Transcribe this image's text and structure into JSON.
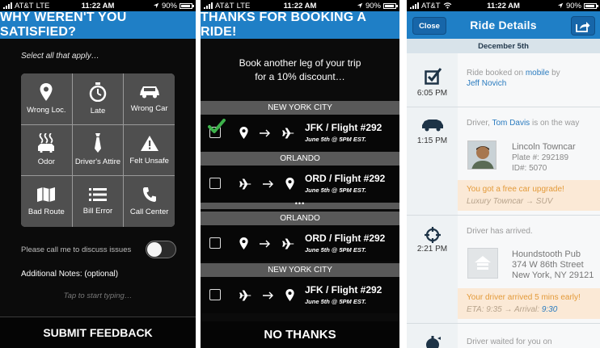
{
  "status_bar": {
    "carrier": "AT&T",
    "network": "LTE",
    "time": "11:22 AM",
    "battery": "90%"
  },
  "feedback_screen": {
    "title": "WHY WEREN'T YOU SATISFIED?",
    "instruction": "Select all that apply…",
    "options": [
      {
        "label": "Wrong Loc.",
        "icon": "map-pin-icon"
      },
      {
        "label": "Late",
        "icon": "stopwatch-icon"
      },
      {
        "label": "Wrong Car",
        "icon": "car-icon"
      },
      {
        "label": "Odor",
        "icon": "odor-icon"
      },
      {
        "label": "Driver's Attire",
        "icon": "tie-icon"
      },
      {
        "label": "Felt Unsafe",
        "icon": "warning-icon"
      },
      {
        "label": "Bad Route",
        "icon": "map-icon"
      },
      {
        "label": "Bill Error",
        "icon": "list-icon"
      },
      {
        "label": "Call Center",
        "icon": "phone-icon"
      }
    ],
    "call_me_label": "Please call me to discuss issues",
    "call_me_enabled": false,
    "notes_label": "Additional Notes: (optional)",
    "notes_placeholder": "Tap to start typing…",
    "submit_label": "SUBMIT FEEDBACK"
  },
  "booking_screen": {
    "title": "THANKS FOR BOOKING A RIDE!",
    "promo_line1": "Book another leg of your trip",
    "promo_line2": "for a 10% discount…",
    "legs": [
      {
        "city": "NEW YORK CITY",
        "title": "JFK / Flight #292",
        "subtitle": "June 5th @ 5PM EST.",
        "direction": "to-airport",
        "checked": true
      },
      {
        "city": "ORLANDO",
        "title": "ORD / Flight #292",
        "subtitle": "June 5th @ 5PM EST.",
        "direction": "from-airport",
        "checked": false
      },
      {
        "city": "ORLANDO",
        "title": "ORD / Flight #292",
        "subtitle": "June 5th @ 5PM EST.",
        "direction": "to-airport",
        "checked": false
      },
      {
        "city": "NEW YORK CITY",
        "title": "JFK / Flight #292",
        "subtitle": "June 5th @ 5PM EST.",
        "direction": "from-airport",
        "checked": false
      }
    ],
    "ellipsis": "•••",
    "no_thanks_label": "NO THANKS"
  },
  "ride_screen": {
    "close_label": "Close",
    "title": "Ride Details",
    "date": "December 5th",
    "events": [
      {
        "time": "6:05 PM",
        "icon": "checkbox-icon",
        "text_prefix": "Ride booked on ",
        "channel": "mobile",
        "text_mid": " by",
        "person": "Jeff Novich"
      },
      {
        "time": "1:15 PM",
        "icon": "car-icon",
        "text_prefix": "Driver, ",
        "driver": "Tom Davis",
        "text_suffix": " is on the way",
        "car_name": "Lincoln Towncar",
        "plate": "Plate #: 292189",
        "id_line": "ID#: 5070",
        "upgrade_text": "You got a free car upgrade!",
        "from_car": "Luxury Towncar",
        "to_car": "SUV",
        "upgrade_arrow": "→"
      },
      {
        "time": "2:21 PM",
        "icon": "crosshair-icon",
        "text": "Driver has arrived.",
        "place": "Houndstooth Pub",
        "addr1": "374 W 86th Street",
        "addr2": "New York, NY 29121",
        "early_text": "Your driver arrived 5 mins early!",
        "eta_label": "ETA: 9:35",
        "arrival_label": "Arrival:",
        "arrival_time": "9:30",
        "arrow": "→"
      },
      {
        "icon": "waiting-icon",
        "text": "Driver waited for you on"
      }
    ]
  },
  "colors": {
    "accent_blue": "#1f7fc6",
    "check_green": "#3db24b",
    "link_blue": "#2a7bbf",
    "promo_orange": "#e39a39"
  }
}
